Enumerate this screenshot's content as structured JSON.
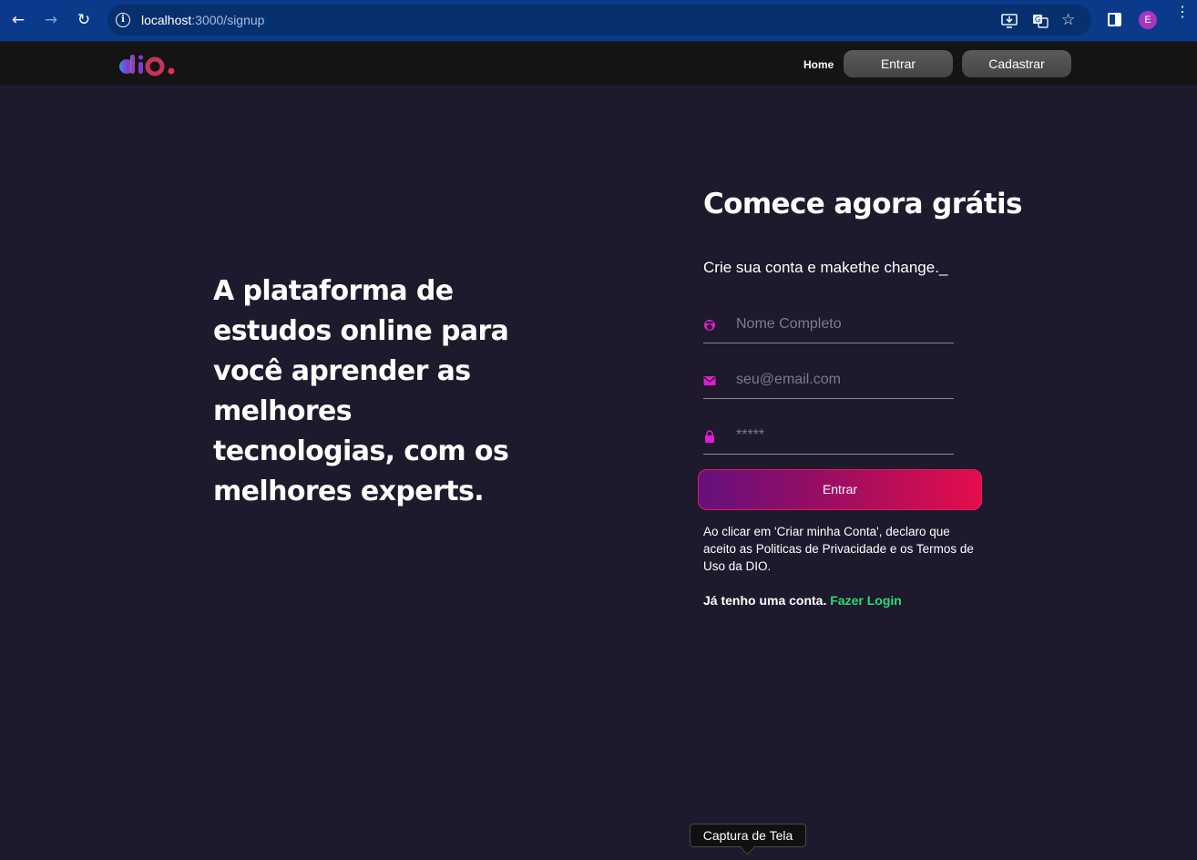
{
  "browser": {
    "url_host": "localhost",
    "url_rest": ":3000/signup",
    "profile_initial": "E",
    "icons": [
      "back-arrow-icon",
      "forward-arrow-icon",
      "reload-icon",
      "site-info-icon",
      "install-app-icon",
      "translate-icon",
      "bookmark-star-icon",
      "side-panel-icon",
      "kebab-menu-icon"
    ]
  },
  "header": {
    "logo": "dio.",
    "nav_home": "Home",
    "login_button": "Entrar",
    "signup_button": "Cadastrar"
  },
  "hero": {
    "text": "A plataforma de estudos online para você aprender as melhores tecnologias, com os melhores experts."
  },
  "form": {
    "title": "Comece agora grátis",
    "subtitle": "Crie sua conta e makethe change._",
    "name_placeholder": "Nome Completo",
    "email_placeholder": "seu@email.com",
    "password_placeholder": "*****",
    "submit_label": "Entrar",
    "terms": "Ao clicar em 'Criar minha Conta', declaro que aceito as Politicas de Privacidade e os Termos de Uso da DIO.",
    "already_text": "Já tenho uma conta.",
    "login_link": "Fazer Login"
  },
  "tooltip": {
    "text": "Captura de Tela"
  },
  "colors": {
    "background": "#1e192c",
    "icon_accent": "#e21dd1",
    "link_green": "#23dd7a",
    "button_gradient_start": "#65107d",
    "button_gradient_end": "#e40d4c"
  }
}
